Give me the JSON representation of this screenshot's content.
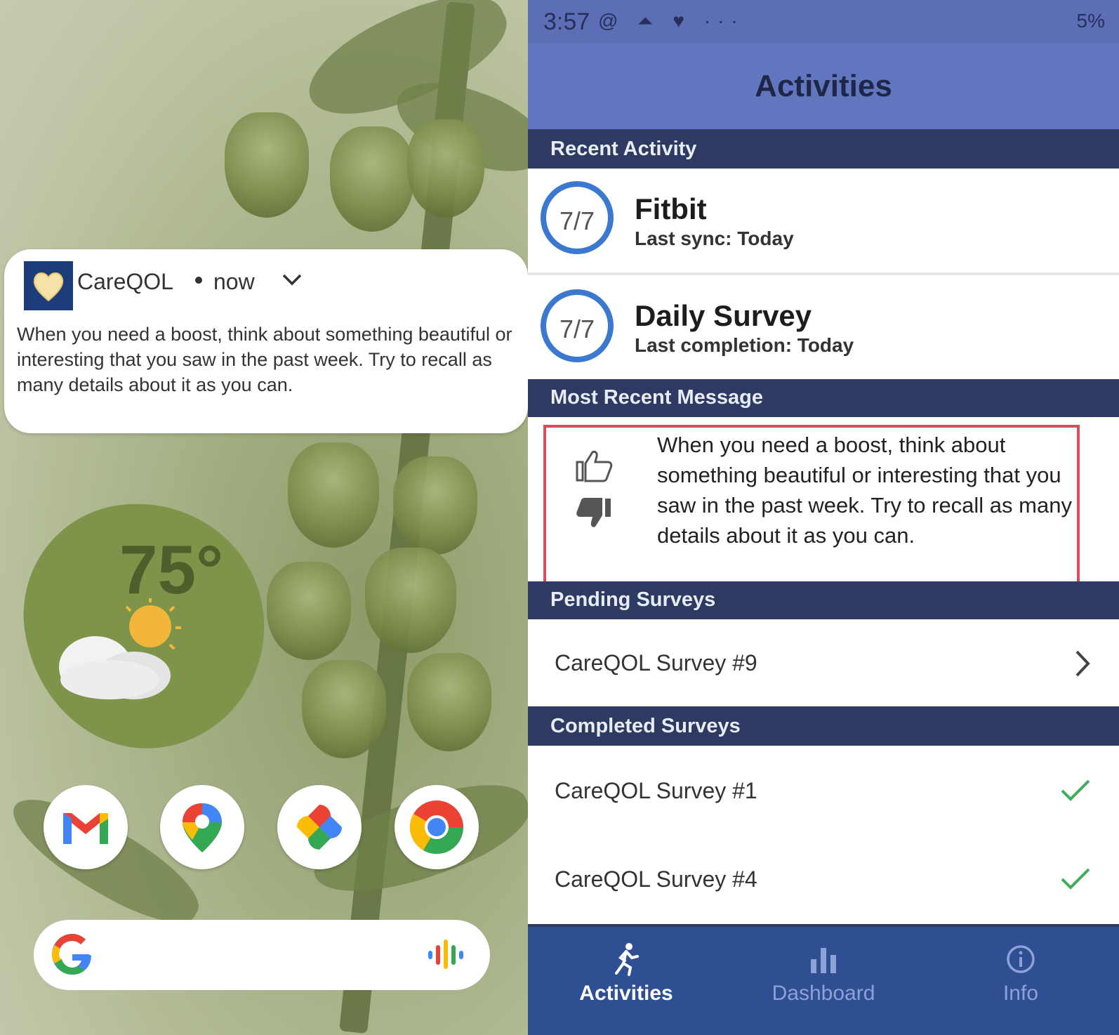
{
  "home_screen": {
    "notification": {
      "app_name": "CareQOL",
      "time": "now",
      "message": "When you need a boost, think about something beautiful or interesting that you saw in the past week. Try to recall as many details about it as you can."
    },
    "weather": {
      "temperature": "75°"
    },
    "dock_apps": [
      {
        "name": "gmail-icon"
      },
      {
        "name": "maps-icon"
      },
      {
        "name": "photos-icon"
      },
      {
        "name": "chrome-icon"
      }
    ]
  },
  "app": {
    "status_bar": {
      "time": "3:57",
      "icons": "@ ⏶ ♥ ···",
      "right": "5%"
    },
    "title": "Activities",
    "sections": {
      "recent": "Recent Activity",
      "message": "Most Recent Message",
      "pending": "Pending Surveys",
      "completed": "Completed Surveys"
    },
    "activities": [
      {
        "name": "Fitbit",
        "sub": "Last sync: Today",
        "progress": "7/7"
      },
      {
        "name": "Daily Survey",
        "sub": "Last completion: Today",
        "progress": "7/7"
      }
    ],
    "recent_message": "When you need a boost, think about something beautiful or interesting that you saw in the past week. Try to recall as many details about it as you can.",
    "pending_surveys": [
      "CareQOL Survey #9"
    ],
    "completed_surveys": [
      "CareQOL Survey #1",
      "CareQOL Survey #4"
    ],
    "tabs": [
      {
        "label": "Activities",
        "active": true
      },
      {
        "label": "Dashboard",
        "active": false
      },
      {
        "label": "Info",
        "active": false
      }
    ],
    "colors": {
      "header": "#6276c0",
      "section": "#2e3a62",
      "tabbar": "#2f4f93",
      "ring": "#3b78d0",
      "highlight": "#d84e57",
      "check": "#3fae5a"
    }
  }
}
